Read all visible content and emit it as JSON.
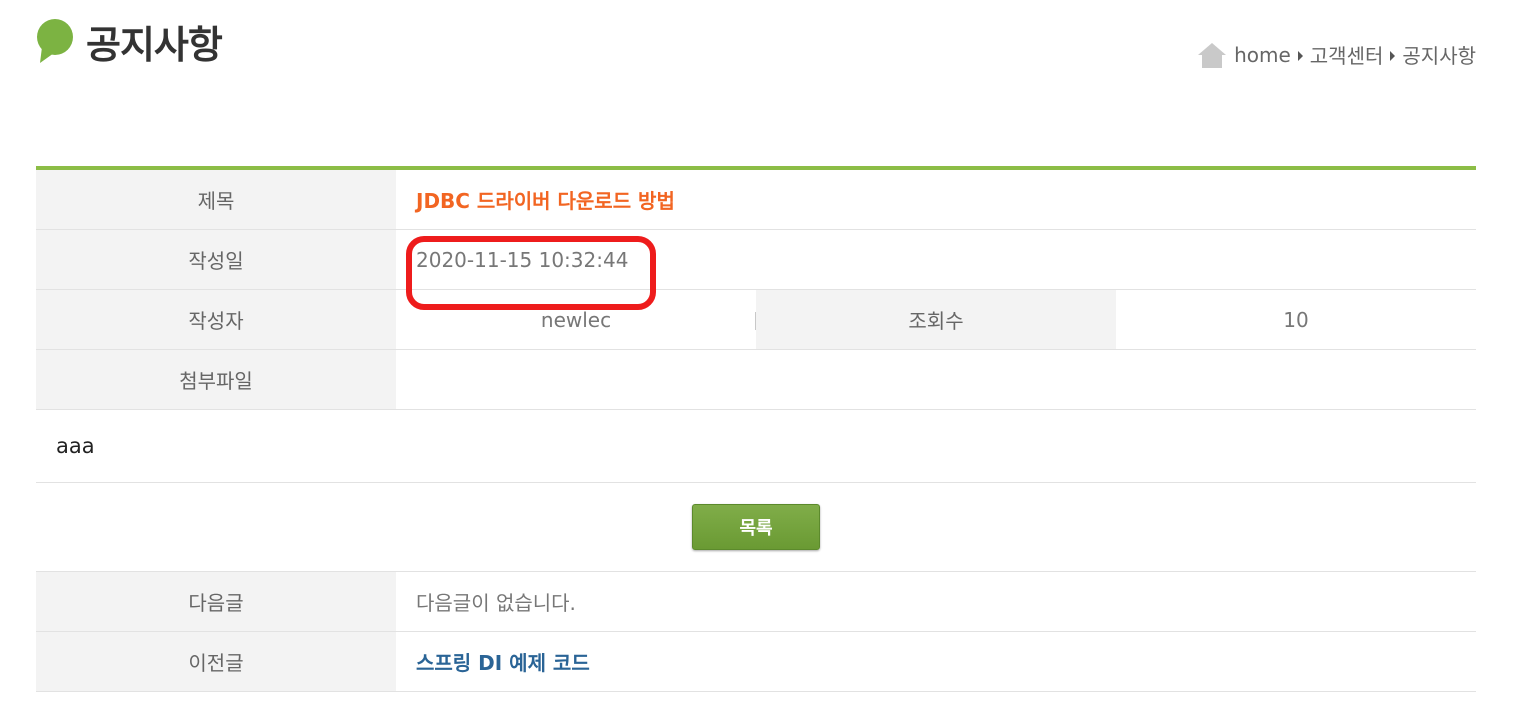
{
  "header": {
    "title": "공지사항",
    "breadcrumb": [
      "home",
      "고객센터",
      "공지사항"
    ]
  },
  "notice": {
    "labels": {
      "title": "제목",
      "date": "작성일",
      "writer": "작성자",
      "views": "조회수",
      "attachment": "첨부파일"
    },
    "title": "JDBC 드라이버 다운로드 방법",
    "date": "2020-11-15 10:32:44",
    "writer": "newlec",
    "views": "10",
    "attachment": "",
    "content": "aaa"
  },
  "actions": {
    "list_label": "목록"
  },
  "navigation": {
    "next_label": "다음글",
    "next_value": "다음글이 없습니다.",
    "prev_label": "이전글",
    "prev_value": "스프링 DI 예제 코드"
  },
  "colors": {
    "accent_green": "#8cbd46",
    "title_orange": "#f26522",
    "highlight_red": "#ee1c1c",
    "link_blue": "#2a6496"
  }
}
